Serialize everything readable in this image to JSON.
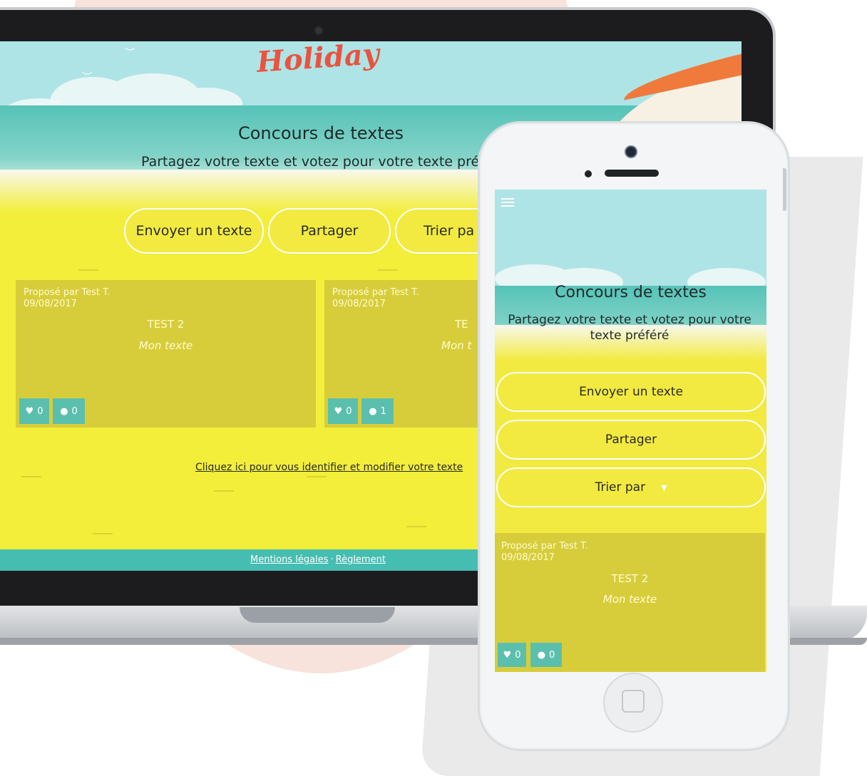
{
  "logo": "Holiday",
  "desktop": {
    "title": "Concours de textes",
    "subtitle": "Partagez votre texte et votez pour votre texte préf",
    "buttons": {
      "send": "Envoyer un texte",
      "share": "Partager",
      "sort": "Trier pa"
    },
    "cards": [
      {
        "author": "Proposé par Test T.",
        "date": "09/08/2017",
        "title": "TEST 2",
        "text": "Mon texte",
        "likes": "0",
        "comments": "0"
      },
      {
        "author": "Proposé par Test T.",
        "date": "09/08/2017",
        "title": "TE",
        "text": "Mon t",
        "likes": "0",
        "comments": "1"
      }
    ],
    "identify_link": "Cliquez ici pour vous identifier et modifier votre texte",
    "footer": {
      "legal": "Mentions légales",
      "separator": "·",
      "rules": "Règlement"
    }
  },
  "mobile": {
    "menu_icon": "hamburger-icon",
    "title": "Concours de textes",
    "subtitle": "Partagez votre texte et votez pour votre texte préféré",
    "buttons": {
      "send": "Envoyer un texte",
      "share": "Partager",
      "sort": "Trier par"
    },
    "card": {
      "author": "Proposé par Test T.",
      "date": "09/08/2017",
      "title": "TEST 2",
      "text": "Mon texte",
      "likes": "0",
      "comments": "0"
    }
  },
  "colors": {
    "sand": "#f2ea40",
    "card": "#d7cd3b",
    "teal": "#5bbfae",
    "sky": "#afe4e6",
    "logo": "#e9533f"
  }
}
